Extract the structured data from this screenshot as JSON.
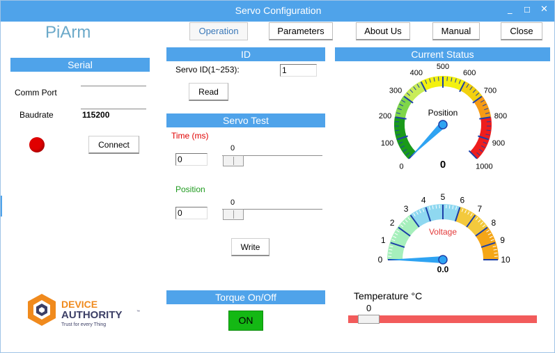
{
  "window": {
    "title": "Servo Configuration",
    "controls": [
      "_",
      "☐",
      "✕"
    ]
  },
  "app_name": "PiArm",
  "nav": {
    "operation": "Operation",
    "parameters": "Parameters",
    "about": "About Us",
    "manual": "Manual",
    "close": "Close",
    "active": "Operation"
  },
  "serial": {
    "header": "Serial",
    "comm_port_label": "Comm Port",
    "comm_port_value": "",
    "baudrate_label": "Baudrate",
    "baudrate_value": "115200",
    "status_color": "#e00000",
    "connect_label": "Connect"
  },
  "id_section": {
    "header": "ID",
    "servo_id_label": "Servo ID(1~253):",
    "servo_id_value": "1",
    "read_label": "Read"
  },
  "servo_test": {
    "header": "Servo Test",
    "time_label": "Time (ms)",
    "time_value": "0",
    "time_slider_value": "0",
    "position_label": "Position",
    "position_value": "0",
    "position_slider_value": "0",
    "write_label": "Write"
  },
  "torque": {
    "header": "Torque On/Off",
    "button_label": "ON",
    "button_color": "#14b814"
  },
  "status": {
    "header": "Current Status",
    "position_gauge": {
      "label": "Position",
      "value": "0",
      "min": 0,
      "max": 1000,
      "ticks": [
        "0",
        "100",
        "200",
        "300",
        "400",
        "500",
        "600",
        "700",
        "800",
        "900",
        "1000"
      ]
    },
    "voltage_gauge": {
      "label": "Voltage",
      "value": "0.0",
      "min": 0,
      "max": 10,
      "ticks": [
        "0",
        "1",
        "2",
        "3",
        "4",
        "5",
        "6",
        "7",
        "8",
        "9",
        "10"
      ]
    }
  },
  "temperature": {
    "label": "Temperature °C",
    "value": "0"
  },
  "logo": {
    "line1": "DEVICE",
    "line2": "AUTHORITY",
    "tm": "™",
    "tagline": "Trust for every Thing",
    "brand_color": "#f08a1d",
    "dark_color": "#3c3f66"
  },
  "colors": {
    "accent": "#4fa3ea",
    "title_text": "#ffffff",
    "active_tab_text": "#3a78b8"
  }
}
